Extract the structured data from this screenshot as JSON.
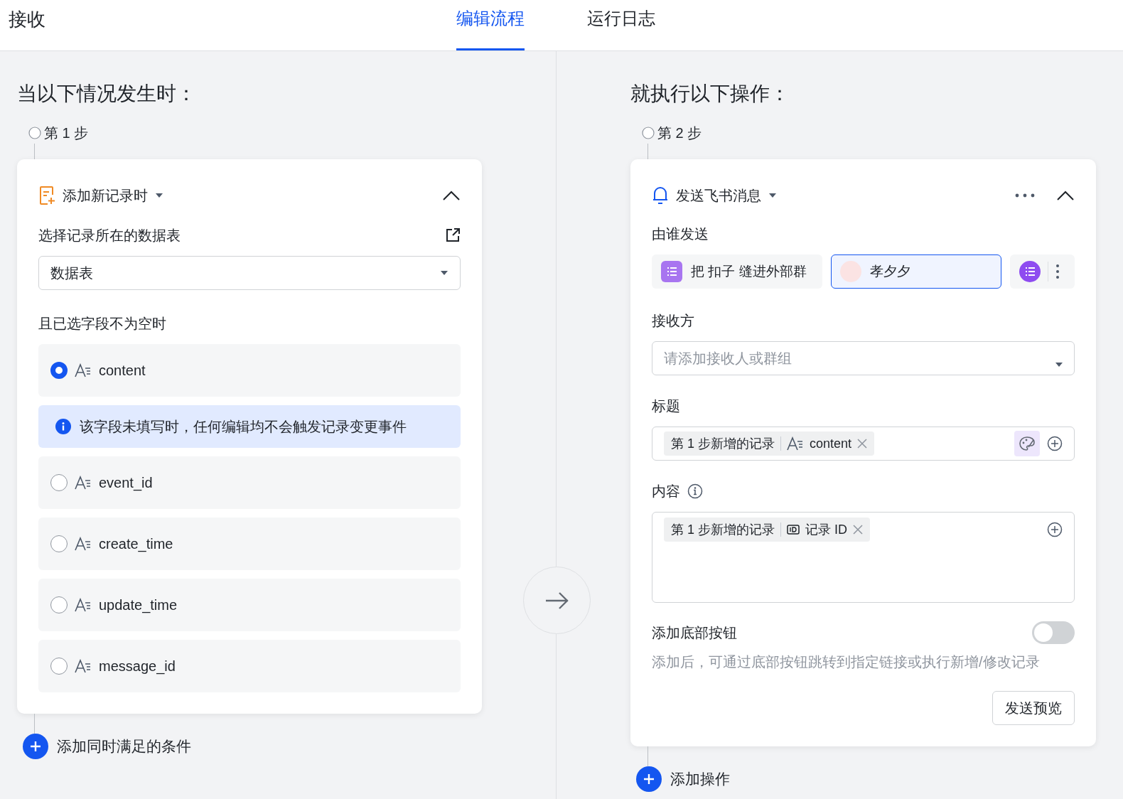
{
  "header": {
    "title": "接收",
    "tabs": [
      {
        "label": "编辑流程",
        "selected": true
      },
      {
        "label": "运行日志",
        "selected": false
      }
    ]
  },
  "trigger_pane": {
    "heading": "当以下情况发生时：",
    "step": "第 1 步",
    "card": {
      "title": "添加新记录时",
      "table_label": "选择记录所在的数据表",
      "table_value": "数据表",
      "fields_label": "且已选字段不为空时",
      "notice": "该字段未填写时，任何编辑均不会触发记录变更事件",
      "fields": [
        {
          "name": "content",
          "selected": true
        },
        {
          "name": "event_id",
          "selected": false
        },
        {
          "name": "create_time",
          "selected": false
        },
        {
          "name": "update_time",
          "selected": false
        },
        {
          "name": "message_id",
          "selected": false
        }
      ]
    },
    "add_button": "添加同时满足的条件"
  },
  "action_pane": {
    "heading": "就执行以下操作：",
    "step": "第 2 步",
    "card": {
      "title": "发送飞书消息",
      "sender_label": "由谁发送",
      "senders": [
        {
          "kind": "bot",
          "label": "把 扣子 缝进外部群",
          "selected": false
        },
        {
          "kind": "user",
          "label": "孝夕夕",
          "selected": true
        },
        {
          "kind": "icon",
          "selected": false
        }
      ],
      "receiver_label": "接收方",
      "receiver": {
        "placeholder": "请添加接收人或群组"
      },
      "title_label": "标题",
      "title_tokens": [
        {
          "source": "第 1 步新增的记录",
          "field": "content",
          "kind": "text"
        }
      ],
      "content_label": "内容",
      "content_tokens": [
        {
          "source": "第 1 步新增的记录",
          "field": "记录 ID",
          "kind": "id"
        }
      ],
      "bottom_button": {
        "label": "添加底部按钮",
        "on": false,
        "description": "添加后，可通过底部按钮跳转到指定链接或执行新增/修改记录"
      },
      "preview_button": "发送预览"
    },
    "add_button": "添加操作"
  }
}
